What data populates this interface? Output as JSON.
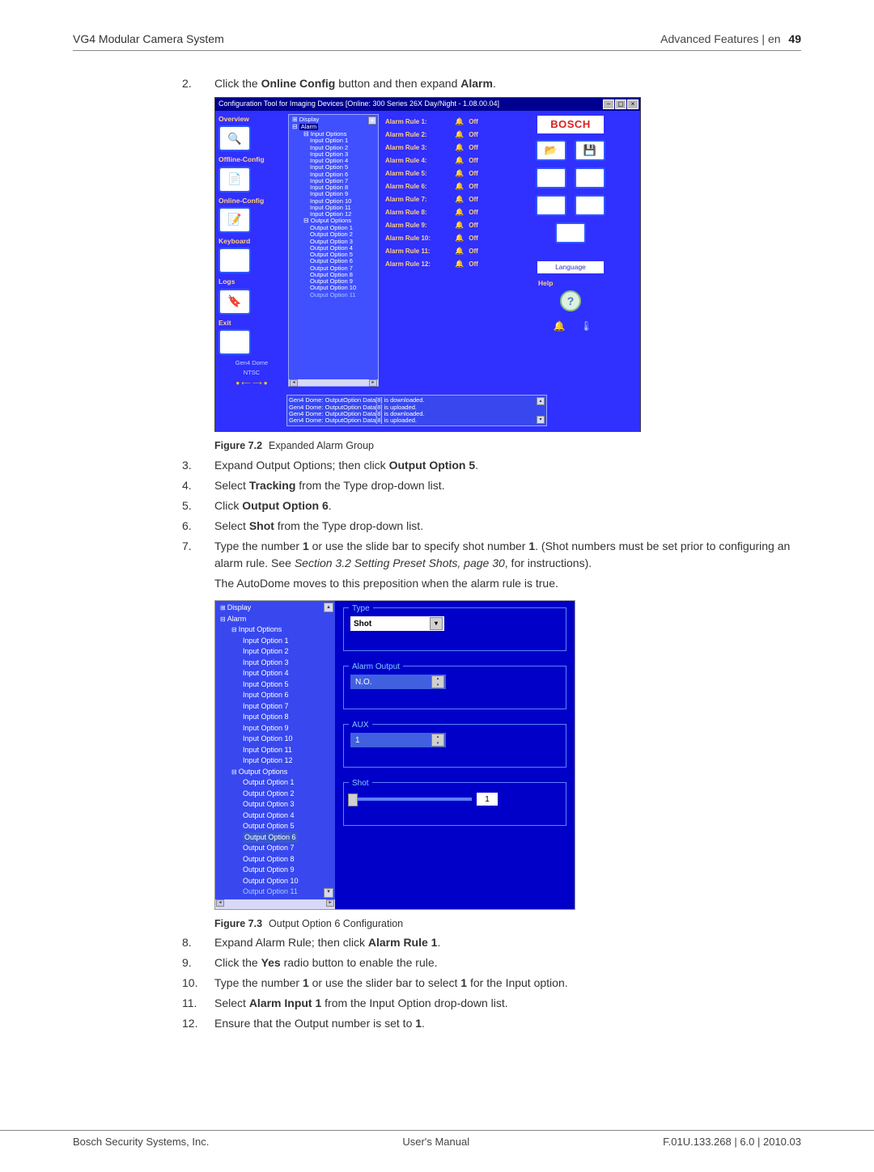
{
  "header": {
    "left": "VG4 Modular Camera System",
    "right": "Advanced Features | en",
    "page": "49"
  },
  "step2": {
    "num": "2.",
    "pre": "Click the ",
    "b1": "Online Config",
    "mid": " button and then expand ",
    "b2": "Alarm",
    "post": "."
  },
  "fig1": {
    "title": "Configuration Tool for Imaging Devices [Online: 300 Series 26X Day/Night - 1.08.00.04]",
    "sidebar": {
      "overview": "Overview",
      "offline": "Offline-Config",
      "online": "Online-Config",
      "keyboard": "Keyboard",
      "logs": "Logs",
      "exit": "Exit",
      "model": "Gen4 Dome",
      "standard": "NTSC",
      "arrows": "● ⟵ ⟶ ●"
    },
    "tree": {
      "display": "Display",
      "alarm": "Alarm",
      "input_group": "Input Options",
      "input_options": [
        "Input Option 1",
        "Input Option 2",
        "Input Option 3",
        "Input Option 4",
        "Input Option 5",
        "Input Option 6",
        "Input Option 7",
        "Input Option 8",
        "Input Option 9",
        "Input Option 10",
        "Input Option 11",
        "Input Option 12"
      ],
      "output_group": "Output Options",
      "output_options": [
        "Output Option 1",
        "Output Option 2",
        "Output Option 3",
        "Output Option 4",
        "Output Option 5",
        "Output Option 6",
        "Output Option 7",
        "Output Option 8",
        "Output Option 9",
        "Output Option 10"
      ],
      "output_cutoff": "Output Option 11"
    },
    "rules": [
      {
        "label": "Alarm Rule 1:",
        "state": "Off"
      },
      {
        "label": "Alarm Rule 2:",
        "state": "Off"
      },
      {
        "label": "Alarm Rule 3:",
        "state": "Off"
      },
      {
        "label": "Alarm Rule 4:",
        "state": "Off"
      },
      {
        "label": "Alarm Rule 5:",
        "state": "Off"
      },
      {
        "label": "Alarm Rule 6:",
        "state": "Off"
      },
      {
        "label": "Alarm Rule 7:",
        "state": "Off"
      },
      {
        "label": "Alarm Rule 8:",
        "state": "Off"
      },
      {
        "label": "Alarm Rule 9:",
        "state": "Off"
      },
      {
        "label": "Alarm Rule 10:",
        "state": "Off"
      },
      {
        "label": "Alarm Rule 11:",
        "state": "Off"
      },
      {
        "label": "Alarm Rule 12:",
        "state": "Off"
      }
    ],
    "right": {
      "bosch": "BOSCH",
      "language": "Language",
      "help": "Help"
    },
    "log": [
      "Gen4 Dome: OutputOption Data[8] is downloaded.",
      "Gen4 Dome: OutputOption Data[8] is uploaded.",
      "Gen4 Dome: OutputOption Data[8] is downloaded.",
      "Gen4 Dome: OutputOption Data[8] is uploaded."
    ]
  },
  "caption1": {
    "label": "Figure 7.2",
    "text": "Expanded Alarm Group"
  },
  "step3": {
    "num": "3.",
    "pre": "Expand Output Options; then click ",
    "b1": "Output Option 5",
    "post": "."
  },
  "step4": {
    "num": "4.",
    "pre": "Select ",
    "b1": "Tracking",
    "post": " from the Type drop-down list."
  },
  "step5": {
    "num": "5.",
    "pre": "Click ",
    "b1": "Output Option 6",
    "post": "."
  },
  "step6": {
    "num": "6.",
    "pre": "Select ",
    "b1": "Shot",
    "post": " from the Type drop-down list."
  },
  "step7": {
    "num": "7.",
    "p1_a": "Type the number ",
    "p1_b1": "1",
    "p1_b": " or use the slide bar to specify shot number ",
    "p1_b2": "1",
    "p1_c": ". (Shot numbers must be set prior to configuring an alarm rule. See ",
    "p1_i": "Section 3.2 Setting Preset Shots, page 30",
    "p1_d": ", for instructions).",
    "p2": "The AutoDome moves to this preposition when the alarm rule is true."
  },
  "fig2": {
    "tree": {
      "display": "Display",
      "alarm": "Alarm",
      "input_group": "Input Options",
      "input_options": [
        "Input Option 1",
        "Input Option 2",
        "Input Option 3",
        "Input Option 4",
        "Input Option 5",
        "Input Option 6",
        "Input Option 7",
        "Input Option 8",
        "Input Option 9",
        "Input Option 10",
        "Input Option 11",
        "Input Option 12"
      ],
      "output_group": "Output Options",
      "output_options": [
        "Output Option 1",
        "Output Option 2",
        "Output Option 3",
        "Output Option 4",
        "Output Option 5",
        "Output Option 6",
        "Output Option 7",
        "Output Option 8",
        "Output Option 9",
        "Output Option 10"
      ],
      "output_cutoff": "Output Option 11"
    },
    "groups": {
      "type_label": "Type",
      "type_value": "Shot",
      "alarm_output_label": "Alarm Output",
      "alarm_output_value": "N.O.",
      "aux_label": "AUX",
      "aux_value": "1",
      "shot_label": "Shot",
      "shot_value": "1"
    }
  },
  "caption2": {
    "label": "Figure 7.3",
    "text": "Output Option 6 Configuration"
  },
  "step8": {
    "num": "8.",
    "pre": "Expand Alarm Rule; then click ",
    "b1": "Alarm Rule 1",
    "post": "."
  },
  "step9": {
    "num": "9.",
    "pre": "Click the ",
    "b1": "Yes",
    "post": " radio button to enable the rule."
  },
  "step10": {
    "num": "10.",
    "pre": "Type the number ",
    "b1": "1",
    "mid": " or use the slider bar to select ",
    "b2": "1",
    "post": " for the Input option."
  },
  "step11": {
    "num": "11.",
    "pre": "Select ",
    "b1": "Alarm Input 1",
    "post": " from the Input Option drop-down list."
  },
  "step12": {
    "num": "12.",
    "pre": "Ensure that the Output number is set to ",
    "b1": "1",
    "post": "."
  },
  "footer": {
    "left": "Bosch Security Systems, Inc.",
    "center": "User's Manual",
    "right": "F.01U.133.268 | 6.0 | 2010.03"
  }
}
